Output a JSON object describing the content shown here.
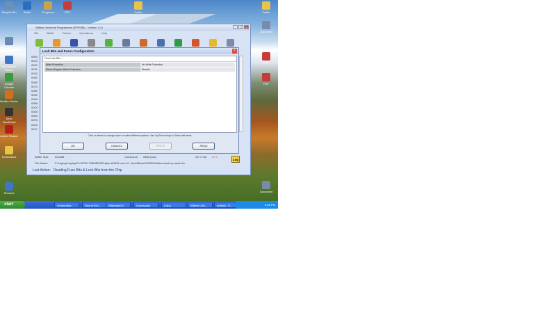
{
  "desktop": {
    "icons_left": [
      {
        "label": "My Computer",
        "color": "#6a88b6"
      },
      {
        "label": "My Network Places",
        "color": "#3f76c9"
      },
      {
        "label": "Google Chrome",
        "color": "#3a9a40"
      },
      {
        "label": "Mozilla Firefox",
        "color": "#d76e1e"
      },
      {
        "label": "Nero StartSmart",
        "color": "#333333"
      },
      {
        "label": "Adobe Reader",
        "color": "#b71c1c"
      },
      {
        "label": "Schematics",
        "color": "#e8c44a"
      },
      {
        "label": "Shortcut",
        "color": "#3f76c9"
      }
    ],
    "icons_top": [
      {
        "label": "Recycle Bin",
        "color": "#6f8fb5"
      },
      {
        "label": "Safari",
        "color": "#2a6fbf"
      },
      {
        "label": "Programs",
        "color": "#c9a34a"
      },
      {
        "label": "PDF",
        "color": "#c73b3b"
      },
      {
        "label": "Folder",
        "color": "#e8c44a"
      }
    ],
    "icons_right": [
      {
        "label": "Folder",
        "color": "#e8c44a"
      },
      {
        "label": "Document",
        "color": "#7a8aa8"
      },
      {
        "label": "PDF",
        "color": "#c73b3b"
      },
      {
        "label": "PDF",
        "color": "#c73b3b"
      },
      {
        "label": "Document",
        "color": "#7a8aa8"
      }
    ]
  },
  "app": {
    "title": "Willem Universal Programmer (EPROM) - Version 4.11",
    "menu": [
      "File",
      "Buffer",
      "Device",
      "Operations",
      "Help"
    ],
    "hex_rows": [
      "0000",
      "0010",
      "0020",
      "0030",
      "0040",
      "0050",
      "0060",
      "0070",
      "0080",
      "0090",
      "00A0",
      "00B0",
      "00C0",
      "00D0",
      "00E0",
      "00F0",
      "0100",
      "0110"
    ],
    "buffer_size_label": "Buffer Size:",
    "buffer_size": "524288",
    "checksum_label": "Checksum:",
    "checksum": "0583 (hex)",
    "okfail_label": "OK / Fail:",
    "okfail": "0 / 0",
    "filename_label": "File Name:",
    "filename": "F:\\Laptop\\Laptop\\FUJITSU SIEMENS\\Fujitsu AH531 core i3 - AmeliBeckSASSEAA\\bios back up amoi.bin",
    "last_action_label": "Last Action:",
    "last_action": "Reading Fuse Bits & Lock Bits from the Chip",
    "log_label": "Log"
  },
  "dialog": {
    "title": "Lock Bits and Fuses Configuration",
    "panel_header": "Fuse/Lock Bits",
    "rows": [
      {
        "name": "Write Protection",
        "value": "No Write Protection"
      },
      {
        "name": "Status Register Write Protection",
        "value": "Disable"
      }
    ],
    "hint": "Click on items to change value or select different options. Use Up/Down Keys to Select list items.",
    "buttons": {
      "ok": "OK",
      "cancel": "CANCEL",
      "write": "WRITE",
      "read": "READ"
    }
  },
  "taskbar": {
    "start": "start",
    "items": [
      "Schematics",
      "How to Ext...",
      "Willemkern2",
      "Downloads",
      "Lotus",
      "Willem Univ...",
      "untitled - P..."
    ],
    "clock": "5:46 PM"
  }
}
